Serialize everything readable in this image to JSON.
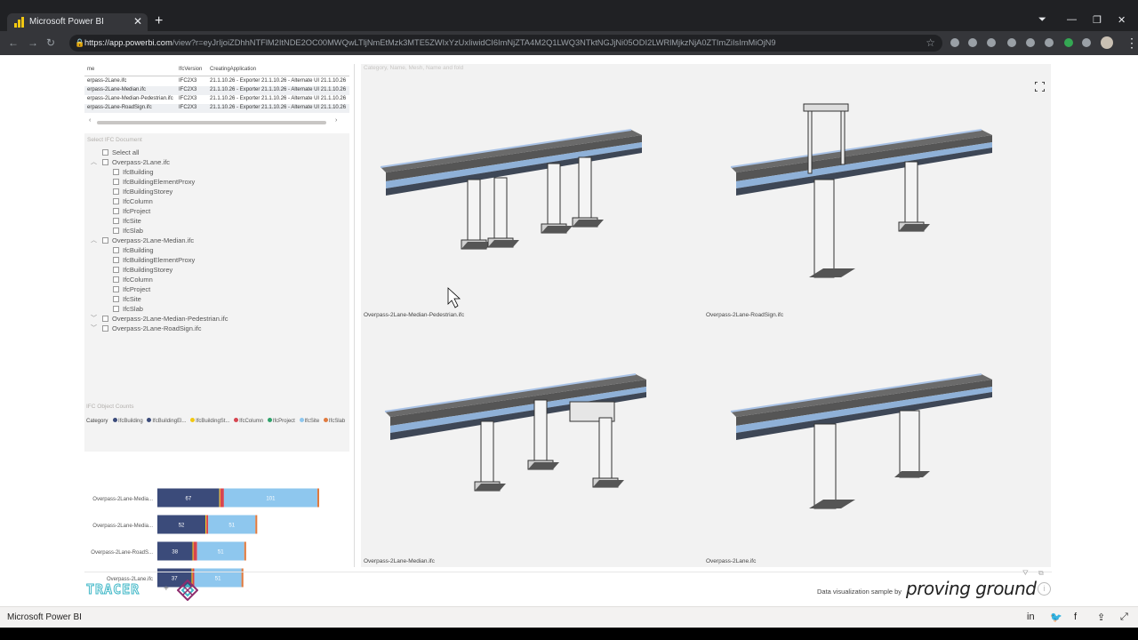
{
  "browser": {
    "tab_title": "Microsoft Power BI",
    "url_host": "https://app.powerbi.com",
    "url_path": "/view?r=eyJrIjoiZDhhNTFlM2ItNDE2OC00MWQwLTljNmEtMzk3MTE5ZWIxYzUxIiwidCI6ImNjZTA4M2Q1LWQ3NTktNGJjNi05ODI2LWRlMjkzNjA0ZTImZiIsImMiOjN9"
  },
  "table": {
    "headers": [
      "me",
      "IfcVersion",
      "CreatingApplication"
    ],
    "rows": [
      {
        "name": "erpass-2Lane.ifc",
        "version": "IFC2X3",
        "app": "21.1.10.26 - Exporter 21.1.10.26 - Alternate UI 21.1.10.26"
      },
      {
        "name": "erpass-2Lane-Median.ifc",
        "version": "IFC2X3",
        "app": "21.1.10.26 - Exporter 21.1.10.26 - Alternate UI 21.1.10.26"
      },
      {
        "name": "erpass-2Lane-Median-Pedestrian.ifc",
        "version": "IFC2X3",
        "app": "21.1.10.26 - Exporter 21.1.10.26 - Alternate UI 21.1.10.26"
      },
      {
        "name": "erpass-2Lane-RoadSign.ifc",
        "version": "IFC2X3",
        "app": "21.1.10.26 - Exporter 21.1.10.26 - Alternate UI 21.1.10.26"
      }
    ]
  },
  "slicer": {
    "title": "Select IFC Document",
    "select_all": "Select all",
    "documents": [
      {
        "name": "Overpass-2Lane.ifc",
        "children": [
          "IfcBuilding",
          "IfcBuildingElementProxy",
          "IfcBuildingStorey",
          "IfcColumn",
          "IfcProject",
          "IfcSite",
          "IfcSlab"
        ]
      },
      {
        "name": "Overpass-2Lane-Median.ifc",
        "children": [
          "IfcBuilding",
          "IfcBuildingElementProxy",
          "IfcBuildingStorey",
          "IfcColumn",
          "IfcProject",
          "IfcSite",
          "IfcSlab"
        ]
      },
      {
        "name": "Overpass-2Lane-Median-Pedestrian.ifc",
        "children": []
      },
      {
        "name": "Overpass-2Lane-RoadSign.ifc",
        "children": []
      }
    ]
  },
  "colors": {
    "IfcBuilding": "#3b4b7a",
    "IfcBuildingElementProxy": "#3b4b7a",
    "IfcBuildingStorey": "#f2c811",
    "IfcColumn": "#d64550",
    "IfcProject": "#2fa36b",
    "IfcSite": "#8ec7ee",
    "IfcSlab": "#e07a3f"
  },
  "chart_data": {
    "type": "bar",
    "orientation": "horizontal",
    "stacked": true,
    "title": "IFC Object Counts",
    "legend_title": "Category",
    "legend_labels": [
      "IfcBuilding",
      "IfcBuildingEl...",
      "IfcBuildingSt...",
      "IfcColumn",
      "IfcProject",
      "IfcSite",
      "IfcSlab"
    ],
    "categories": [
      "Overpass-2Lane-Media...",
      "Overpass-2Lane-Media...",
      "Overpass-2Lane-RoadS...",
      "Overpass-2Lane.ifc"
    ],
    "series": [
      {
        "name": "IfcBuildingEl...",
        "values": [
          67,
          52,
          38,
          37
        ],
        "color": "#3b4b7a"
      },
      {
        "name": "IfcBuildingSt...",
        "values": [
          1,
          1,
          1,
          1
        ],
        "color": "#f2c811"
      },
      {
        "name": "IfcColumn",
        "values": [
          4,
          2,
          4,
          2
        ],
        "color": "#d64550"
      },
      {
        "name": "IfcSite",
        "values": [
          101,
          51,
          51,
          51
        ],
        "color": "#8ec7ee"
      },
      {
        "name": "IfcSlab",
        "values": [
          2,
          2,
          2,
          2
        ],
        "color": "#e07a3f"
      }
    ],
    "data_labels": [
      [
        "67",
        "101"
      ],
      [
        "52",
        "51"
      ],
      [
        "38",
        "51"
      ],
      [
        "37",
        "51"
      ]
    ],
    "xticks": [
      "0",
      "50",
      "100",
      "150",
      "200"
    ],
    "xlim": [
      0,
      200
    ]
  },
  "viewer": {
    "title": "Category, Name, Mesh, Name and fold",
    "labels": [
      "Overpass-2Lane-Median-Pedestrian.ifc",
      "Overpass-2Lane-RoadSign.ifc",
      "Overpass-2Lane-Median.ifc",
      "Overpass-2Lane.ifc"
    ]
  },
  "footer": {
    "tracer": "TRACER",
    "plus": "+",
    "sample_text": "Data visualization sample by",
    "brand": "proving ground",
    "info": "i",
    "app_name": "Microsoft Power BI"
  }
}
